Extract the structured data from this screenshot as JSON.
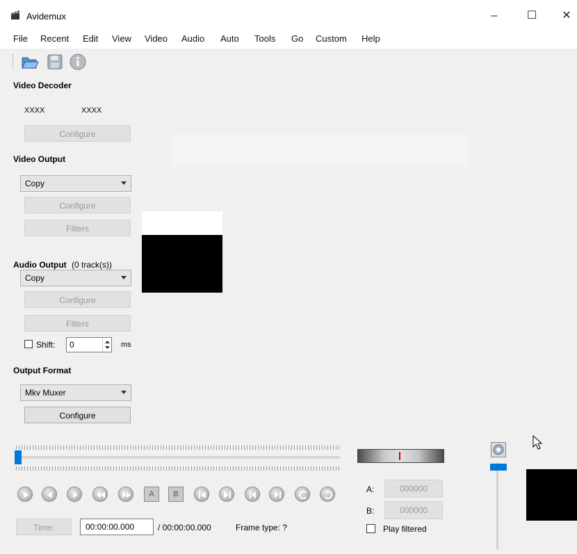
{
  "window": {
    "title": "Avidemux",
    "minimize": "–",
    "maximize": "☐",
    "close": "✕"
  },
  "menu": [
    "File",
    "Recent",
    "Edit",
    "View",
    "Video",
    "Audio",
    "Auto",
    "Tools",
    "Go",
    "Custom",
    "Help"
  ],
  "toolbar": {
    "open_icon": "folder-open-icon",
    "save_icon": "floppy-save-icon",
    "info_icon": "info-icon"
  },
  "video_decoder": {
    "heading": "Video Decoder",
    "codec_a": "XXXX",
    "codec_b": "XXXX",
    "configure": "Configure"
  },
  "video_output": {
    "heading": "Video Output",
    "selected": "Copy",
    "configure": "Configure",
    "filters": "Filters"
  },
  "audio_output": {
    "heading": "Audio Output",
    "tracks": "(0 track(s))",
    "selected": "Copy",
    "configure": "Configure",
    "filters": "Filters",
    "shift_label": "Shift:",
    "shift_value": "0",
    "shift_unit": "ms"
  },
  "output_format": {
    "heading": "Output Format",
    "selected": "Mkv Muxer",
    "configure": "Configure"
  },
  "navigation": {
    "markers": {
      "a": "A",
      "b": "B"
    },
    "time_button": "Time:",
    "time_value": "00:00:00.000",
    "total_time": "/ 00:00:00.000",
    "frame_type": "Frame type: ?",
    "a_label": "A:",
    "a_value": "000000",
    "b_label": "B:",
    "b_value": "000000",
    "play_filtered": "Play filtered",
    "seek_position": 0
  },
  "colors": {
    "accent": "#0078d7",
    "marker_red": "#d40000"
  }
}
